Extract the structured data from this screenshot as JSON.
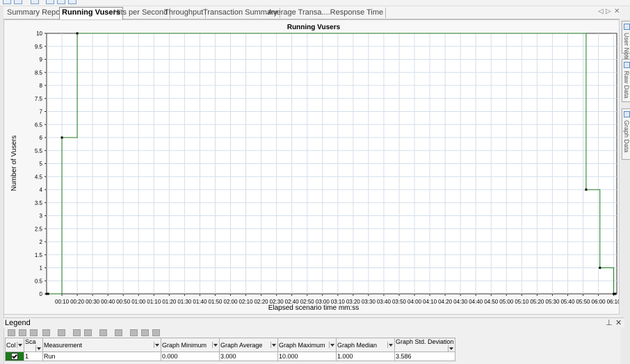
{
  "tabs": [
    {
      "label": "Summary Report",
      "active": false
    },
    {
      "label": "Running Vusers",
      "active": true
    },
    {
      "label": "Hits per Second",
      "active": false
    },
    {
      "label": "Throughput",
      "active": false
    },
    {
      "label": "Transaction Summary",
      "active": false
    },
    {
      "label": "Average Transa....Response Time",
      "active": false
    }
  ],
  "tab_controls": {
    "prev": "◁",
    "next": "▷",
    "close": "✕"
  },
  "side_tabs": [
    "User Notes",
    "Raw Data",
    "Graph Data"
  ],
  "legend": {
    "title": "Legend",
    "pin": "📌",
    "close": "✕",
    "headers": [
      "Col",
      "Sca",
      "Measurement",
      "Graph Minimum",
      "Graph Average",
      "Graph Maximum",
      "Graph Median",
      "Graph Std. Deviation"
    ],
    "rows": [
      {
        "scale": "1",
        "measurement": "Run",
        "minimum": "0.000",
        "average": "3.000",
        "maximum": "10.000",
        "median": "1.000",
        "std_dev": "3.586",
        "color": "#1a7a1a"
      }
    ]
  },
  "chart_data": {
    "type": "line",
    "step": true,
    "title": "Running Vusers",
    "xlabel": "Elapsed scenario time mm:ss",
    "ylabel": "Number of Vusers",
    "ylim": [
      0,
      10
    ],
    "yticks": [
      "0",
      "0.5",
      "1",
      "1.5",
      "2",
      "2.5",
      "3",
      "3.5",
      "4",
      "4.5",
      "5",
      "5.5",
      "6",
      "6.5",
      "7",
      "7.5",
      "8",
      "8.5",
      "9",
      "9.5",
      "10"
    ],
    "xlim": [
      "00:00",
      "06:12"
    ],
    "xticks": [
      "00:10",
      "00:20",
      "00:30",
      "00:40",
      "00:50",
      "01:00",
      "01:10",
      "01:20",
      "01:30",
      "01:40",
      "01:50",
      "02:00",
      "02:10",
      "02:20",
      "02:30",
      "02:40",
      "02:50",
      "03:00",
      "03:10",
      "03:20",
      "03:30",
      "03:40",
      "03:50",
      "04:00",
      "04:10",
      "04:20",
      "04:30",
      "04:40",
      "04:50",
      "05:00",
      "05:10",
      "05:20",
      "05:30",
      "05:40",
      "05:50",
      "06:00",
      "06:10"
    ],
    "grid": true,
    "series": [
      {
        "name": "Run",
        "color": "#1a7a1a",
        "points": [
          [
            "00:00",
            0
          ],
          [
            "00:01",
            0
          ],
          [
            "00:10",
            6
          ],
          [
            "00:20",
            10
          ],
          [
            "05:52",
            4
          ],
          [
            "06:01",
            1
          ],
          [
            "06:10",
            0
          ],
          [
            "06:11",
            0
          ]
        ]
      }
    ]
  }
}
